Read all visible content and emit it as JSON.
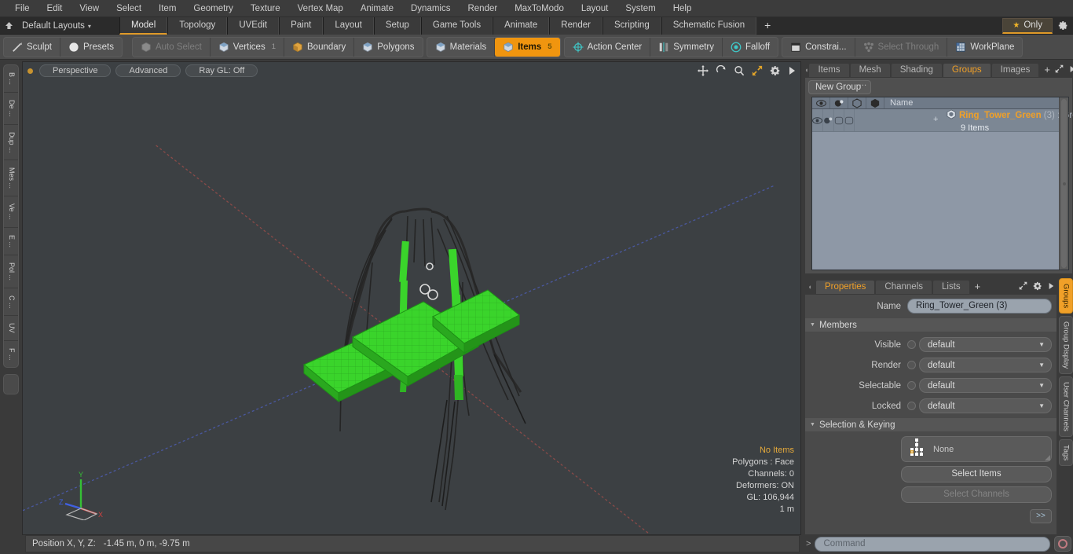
{
  "menubar": {
    "items": [
      "File",
      "Edit",
      "View",
      "Select",
      "Item",
      "Geometry",
      "Texture",
      "Vertex Map",
      "Animate",
      "Dynamics",
      "Render",
      "MaxToModo",
      "Layout",
      "System",
      "Help"
    ]
  },
  "layoutbar": {
    "home_icon": "home-icon",
    "layout_name": "Default Layouts",
    "caret": "▾",
    "tabs": [
      {
        "label": "Model",
        "active": true
      },
      {
        "label": "Topology",
        "active": false
      },
      {
        "label": "UVEdit",
        "active": false
      },
      {
        "label": "Paint",
        "active": false
      },
      {
        "label": "Layout",
        "active": false
      },
      {
        "label": "Setup",
        "active": false
      },
      {
        "label": "Game Tools",
        "active": false
      },
      {
        "label": "Animate",
        "active": false
      },
      {
        "label": "Render",
        "active": false
      },
      {
        "label": "Scripting",
        "active": false
      },
      {
        "label": "Schematic Fusion",
        "active": false
      }
    ],
    "add_tab": "+",
    "only_button": {
      "label": "Only",
      "star": "★"
    },
    "gear": "gear-icon",
    "accent": "#e09a28"
  },
  "modebar": {
    "group_a": [
      {
        "label": "Sculpt",
        "icon": "pencil-icon",
        "state": "normal"
      },
      {
        "label": "Presets",
        "icon": "sphere-icon",
        "state": "normal"
      }
    ],
    "group_b": [
      {
        "label": "Auto Select",
        "icon": "cube-gray-icon",
        "state": "dim",
        "num": ""
      },
      {
        "label": "Vertices",
        "icon": "cube-blue-icon",
        "state": "normal",
        "num": "1"
      },
      {
        "label": "Boundary",
        "icon": "cube-orange-icon",
        "state": "normal",
        "num": ""
      },
      {
        "label": "Polygons",
        "icon": "cube-blue-icon",
        "state": "normal",
        "num": ""
      }
    ],
    "group_c": [
      {
        "label": "Materials",
        "icon": "cube-blue-icon",
        "state": "normal",
        "num": ""
      },
      {
        "label": "Items",
        "icon": "cube-blue-icon",
        "state": "active",
        "num": "5"
      }
    ],
    "group_d": [
      {
        "label": "Action Center",
        "icon": "crosshair-icon",
        "state": "normal"
      },
      {
        "label": "Symmetry",
        "icon": "symmetry-icon",
        "state": "normal"
      },
      {
        "label": "Falloff",
        "icon": "target-icon",
        "state": "normal"
      }
    ],
    "group_e": [
      {
        "label": "Constrai...",
        "icon": "square-icon",
        "state": "normal"
      },
      {
        "label": "Select Through",
        "icon": "dots-icon",
        "state": "dim"
      },
      {
        "label": "WorkPlane",
        "icon": "grid-icon",
        "state": "normal"
      }
    ],
    "active_color": "#f0950f"
  },
  "left_tabs": [
    "B ...",
    "De ...",
    "Dup ...",
    "Mes ...",
    "Ve ...",
    "E ...",
    "Pol ...",
    "C ...",
    "UV",
    "F ..."
  ],
  "viewport": {
    "pills": [
      "Perspective",
      "Advanced",
      "Ray GL: Off"
    ],
    "icons": [
      "move-icon",
      "rotate-icon",
      "magnifier-icon",
      "fit-icon",
      "gear-icon",
      "chevron-right-icon"
    ],
    "stats": [
      {
        "text": "No Items",
        "highlight": true
      },
      {
        "text": "Polygons : Face",
        "highlight": false
      },
      {
        "text": "Channels: 0",
        "highlight": false
      },
      {
        "text": "Deformers: ON",
        "highlight": false
      },
      {
        "text": "GL: 106,944",
        "highlight": false
      },
      {
        "text": "1 m",
        "highlight": false
      }
    ],
    "axis": {
      "x": "X",
      "y": "Y",
      "z": "Z",
      "x_color": "#d04040",
      "y_color": "#35c035",
      "z_color": "#4060e0"
    },
    "background": "#3c4043",
    "model_color": "#3ad42b"
  },
  "right_panel": {
    "tabs": [
      {
        "label": "Items",
        "active": false
      },
      {
        "label": "Mesh ...",
        "active": false
      },
      {
        "label": "Shading",
        "active": false
      },
      {
        "label": "Groups",
        "active": true
      },
      {
        "label": "Images",
        "active": false
      }
    ],
    "add_tab": "+",
    "tab_icons": [
      "expand-icon",
      "chevron-right-icon"
    ],
    "new_group_button": "New Group",
    "tree": {
      "header_icons": [
        "eye-icon",
        "render-icon",
        "wire-icon",
        "shade-icon"
      ],
      "name_column": "Name",
      "rows": [
        {
          "name": "Ring_Tower_Green",
          "count": "(3)",
          "type": ": Group",
          "sub": "9 Items",
          "expand": "+",
          "icons": [
            "eye-icon",
            "render-icon",
            "checkbox-icon",
            "checkbox-icon"
          ]
        }
      ]
    }
  },
  "properties": {
    "tabs": [
      {
        "label": "Properties",
        "active": true
      },
      {
        "label": "Channels",
        "active": false
      },
      {
        "label": "Lists",
        "active": false
      }
    ],
    "add_tab": "+",
    "header_icons": [
      "expand-icon",
      "gear-icon",
      "chevron-right-icon"
    ],
    "name_label": "Name",
    "name_value": "Ring_Tower_Green (3)",
    "sections": [
      {
        "title": "Members",
        "triangle": "▼"
      },
      {
        "title": "Selection & Keying",
        "triangle": "▼"
      }
    ],
    "member_fields": [
      {
        "label": "Visible",
        "value": "default"
      },
      {
        "label": "Render",
        "value": "default"
      },
      {
        "label": "Selectable",
        "value": "default"
      },
      {
        "label": "Locked",
        "value": "default"
      }
    ],
    "keying": {
      "widget_icon": "tree-nodes-icon",
      "widget_value": "None",
      "buttons": [
        {
          "label": "Select Items",
          "enabled": true
        },
        {
          "label": "Select Channels",
          "enabled": false
        }
      ],
      "advanced": ">>"
    },
    "side_tabs": [
      {
        "label": "Groups",
        "active": true
      },
      {
        "label": "Group Display",
        "active": false
      },
      {
        "label": "User Channels",
        "active": false
      },
      {
        "label": "Tags",
        "active": false
      }
    ]
  },
  "statusbar": {
    "position_label": "Position X, Y, Z:",
    "position_value": "-1.45 m, 0 m, -9.75 m",
    "command_chevron": ">",
    "command_placeholder": "Command",
    "record_button": "record-icon"
  }
}
